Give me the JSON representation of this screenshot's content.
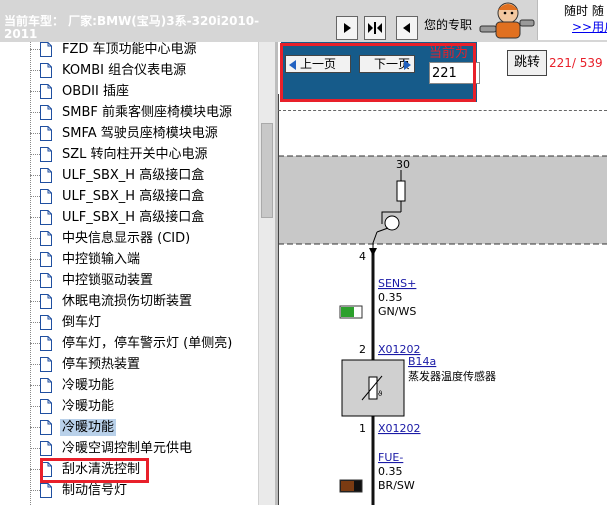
{
  "header": {
    "car_label": "当前车型： 厂家:BMW(宝马)3系-320i2010-2011",
    "your_pro": "您的专职",
    "promo_line1": "随时 随",
    "promo_line2": ">>用户"
  },
  "tree": {
    "items": [
      {
        "label": "FZD 车顶功能中心电源"
      },
      {
        "label": "KOMBI 组合仪表电源"
      },
      {
        "label": "OBDII 插座"
      },
      {
        "label": "SMBF 前乘客侧座椅模块电源"
      },
      {
        "label": "SMFA 驾驶员座椅模块电源"
      },
      {
        "label": "SZL 转向柱开关中心电源"
      },
      {
        "label": "ULF_SBX_H 高级接口盒"
      },
      {
        "label": "ULF_SBX_H 高级接口盒"
      },
      {
        "label": "ULF_SBX_H 高级接口盒"
      },
      {
        "label": "中央信息显示器 (CID)"
      },
      {
        "label": "中控锁输入端"
      },
      {
        "label": "中控锁驱动装置"
      },
      {
        "label": "休眠电流损伤切断装置"
      },
      {
        "label": "倒车灯"
      },
      {
        "label": "停车灯，停车警示灯 (单侧亮)"
      },
      {
        "label": "停车预热装置"
      },
      {
        "label": "冷暖功能"
      },
      {
        "label": "冷暖功能"
      },
      {
        "label": "冷暖功能"
      },
      {
        "label": "冷暖空调控制单元供电"
      },
      {
        "label": "刮水清洗控制"
      },
      {
        "label": "制动信号灯"
      }
    ],
    "selected_index": 18
  },
  "pager": {
    "prev_label": "上一页",
    "next_label": "下一页",
    "current_label": "当前为",
    "page_value": "221",
    "jump_label": "跳转",
    "page_count": "221/ 539"
  },
  "diagram": {
    "fuse_label": "30",
    "pin_top": "4",
    "wire1_name": "SENS+",
    "wire1_size": "0.35",
    "wire1_color": "GN/WS",
    "pin_mid": "2",
    "conn1": "X01202",
    "component_id": "B14a",
    "component_name": "蒸发器温度传感器",
    "pin_bot": "1",
    "conn2": "X01202",
    "wire2_name": "FUE-",
    "wire2_size": "0.35",
    "wire2_color": "BR/SW"
  },
  "colors": {
    "accent_red": "#e8202a",
    "pager_blue": "#165b8a",
    "selection_blue": "#b9d1ea",
    "wire_green": "#2ca02c",
    "wire_brown": "#7a3b12"
  }
}
